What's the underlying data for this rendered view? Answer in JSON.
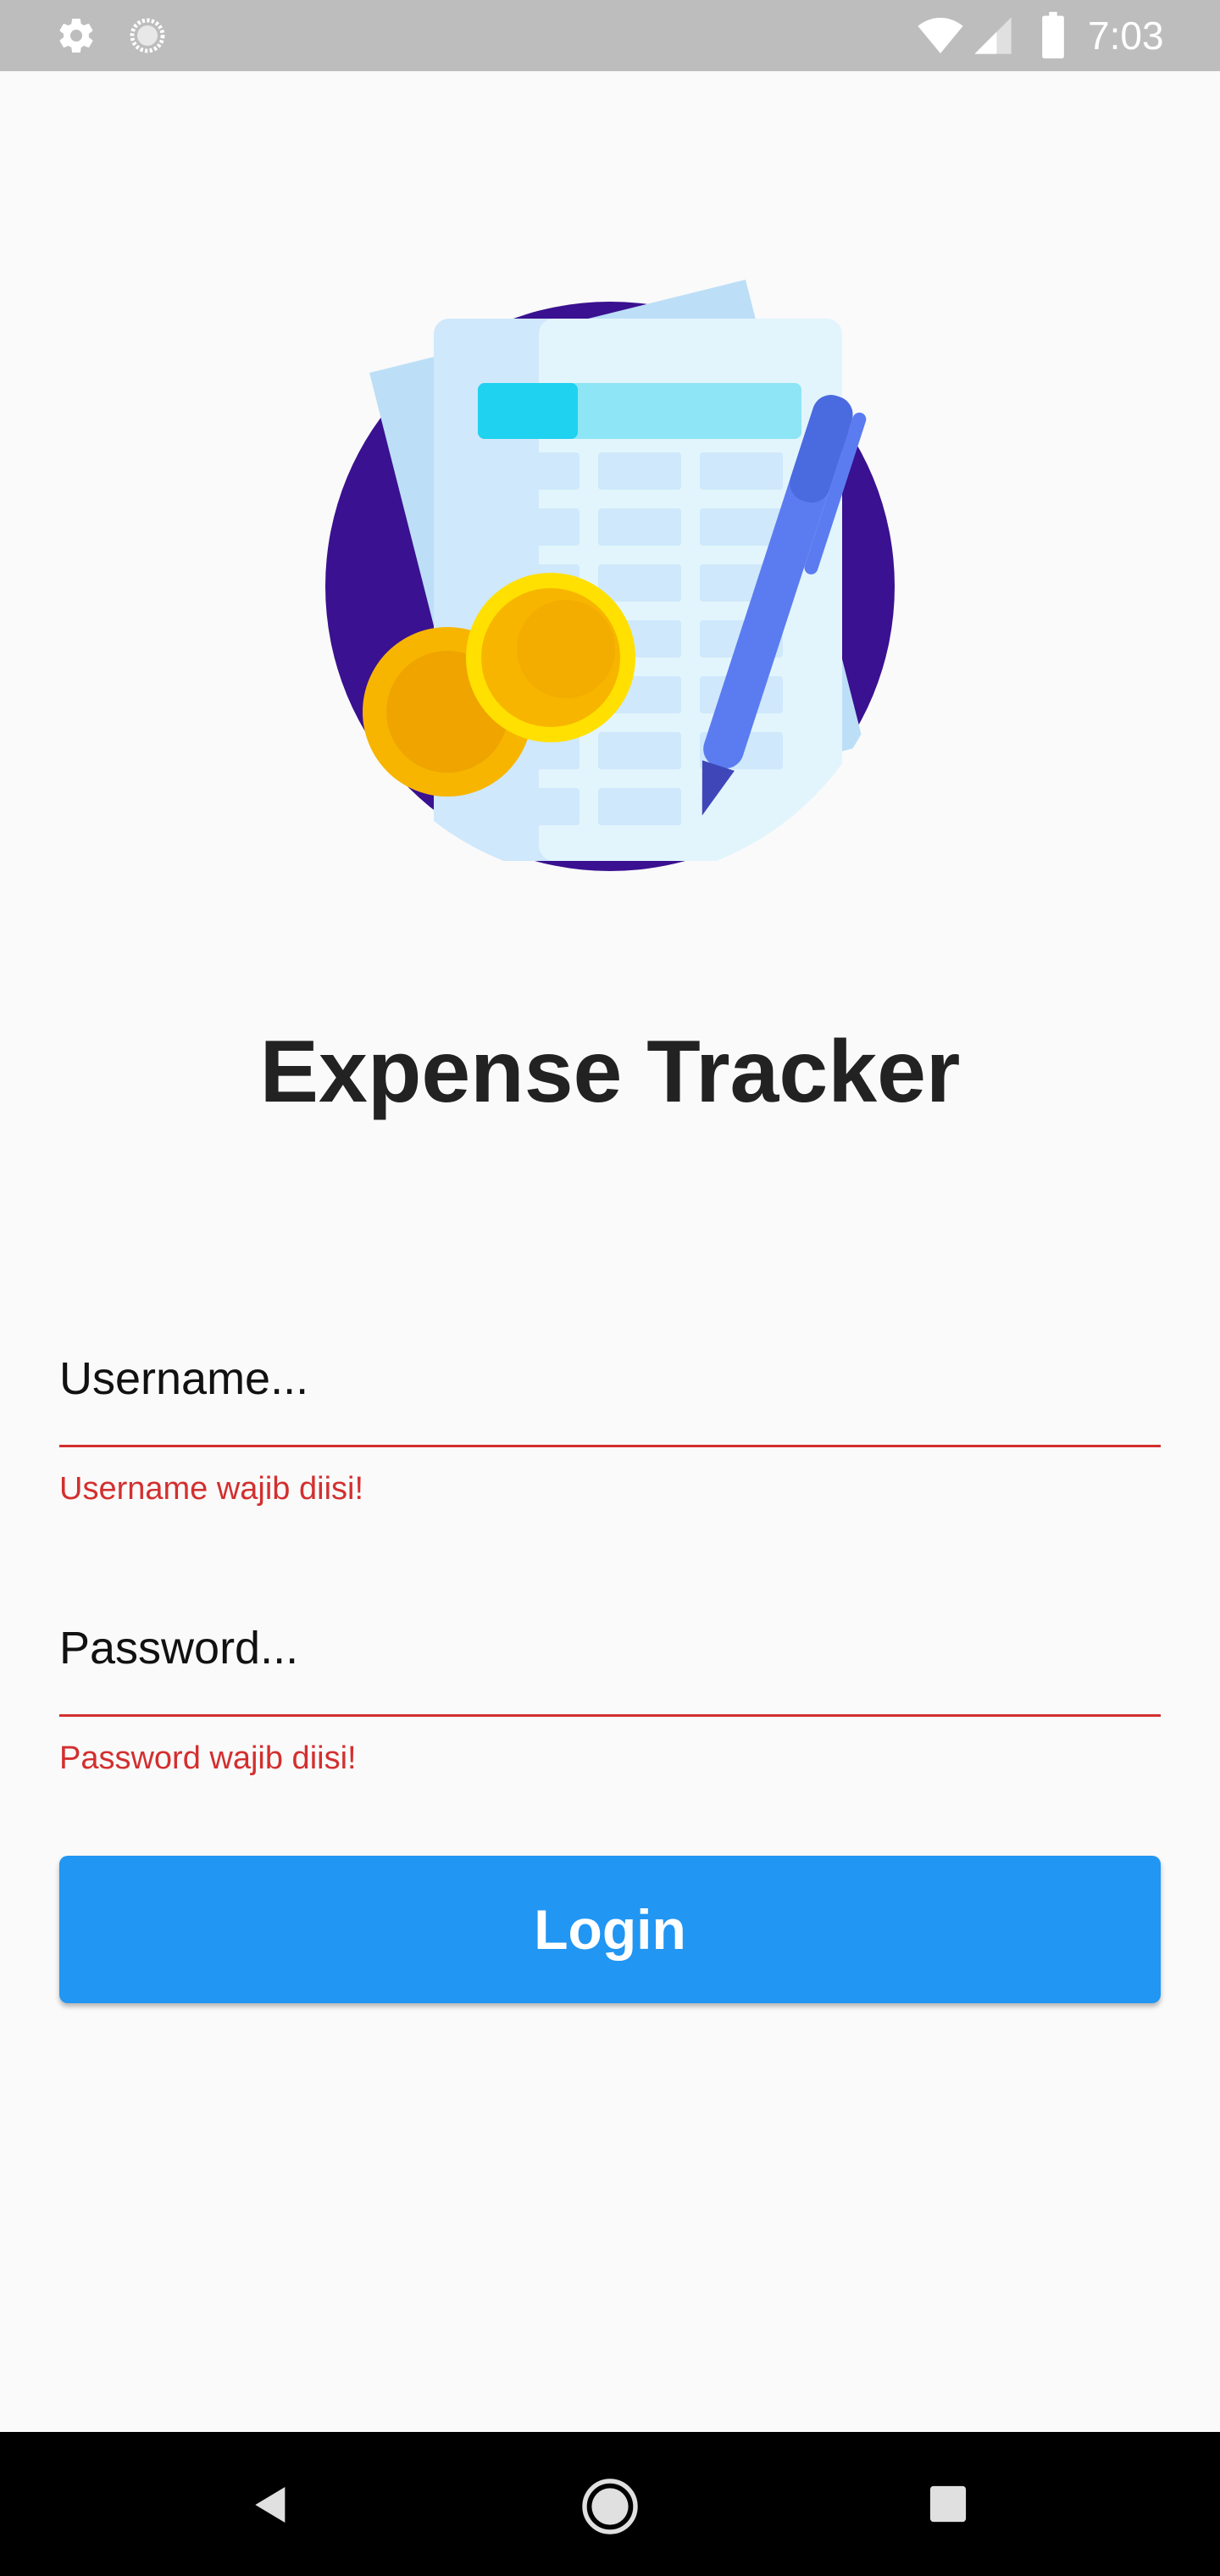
{
  "status_bar": {
    "time": "7:03",
    "icons": [
      "gear-icon",
      "loader-icon",
      "wifi-icon",
      "signal-icon",
      "battery-icon"
    ]
  },
  "hero": {
    "icon": "expense-sheet-illustration",
    "colors": {
      "circle": "#3a1190",
      "paper": "#cfe8fb",
      "coin": "#f7b500",
      "pen": "#5b7cf0"
    }
  },
  "app": {
    "title": "Expense Tracker"
  },
  "form": {
    "username": {
      "placeholder": "Username...",
      "value": "",
      "error": "Username wajib diisi!"
    },
    "password": {
      "placeholder": "Password...",
      "value": "",
      "error": "Password wajib diisi!"
    },
    "login_label": "Login"
  },
  "theme": {
    "accent": "#2196f3",
    "error": "#d32f2f",
    "background": "#fafafa"
  },
  "nav_bar": {
    "icons": [
      "back-icon",
      "home-icon",
      "recent-apps-icon"
    ]
  }
}
